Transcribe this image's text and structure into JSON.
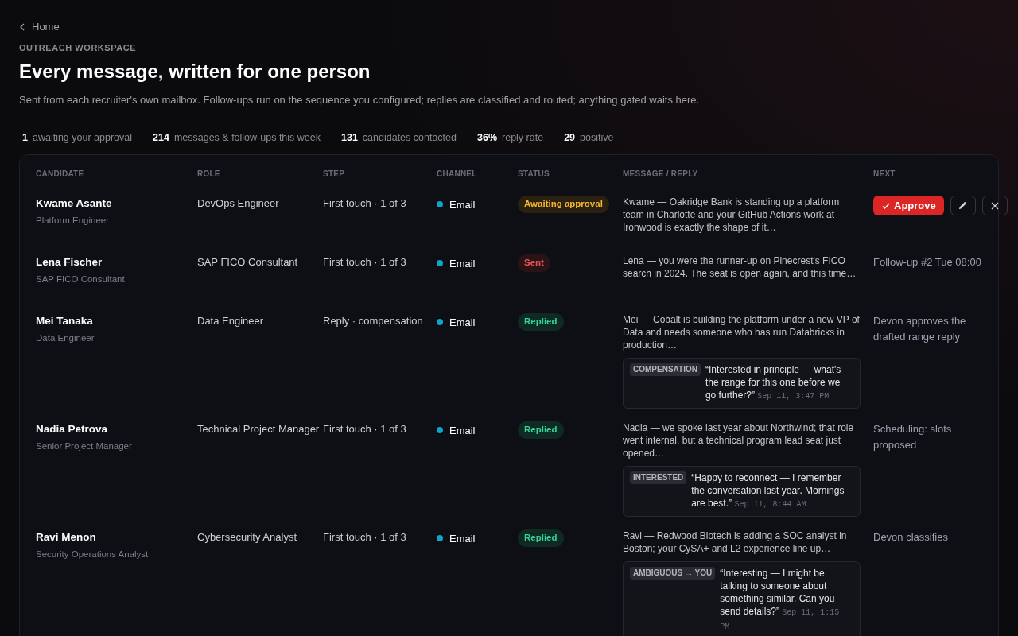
{
  "back_link": {
    "label": "Home"
  },
  "eyebrow": "OUTREACH WORKSPACE",
  "title": "Every message, written for one person",
  "subtitle": "Sent from each recruiter's own mailbox. Follow-ups run on the sequence you configured; replies are classified and routed; anything gated waits here.",
  "stats": [
    {
      "value": "1",
      "label": "awaiting your approval"
    },
    {
      "value": "214",
      "label": "messages & follow-ups this week"
    },
    {
      "value": "131",
      "label": "candidates contacted"
    },
    {
      "value": "36%",
      "label": "reply rate"
    },
    {
      "value": "29",
      "label": "positive"
    }
  ],
  "table": {
    "columns": [
      "CANDIDATE",
      "ROLE",
      "STEP",
      "CHANNEL",
      "STATUS",
      "MESSAGE / REPLY",
      "NEXT"
    ],
    "rows": [
      {
        "name": "Kwame Asante",
        "title": "Platform Engineer",
        "role": "DevOps Engineer",
        "step": "First touch · 1 of 3",
        "channel": "Email",
        "status": {
          "kind": "awaiting",
          "label": "Awaiting approval"
        },
        "message": "Kwame — Oakridge Bank is standing up a platform team in Charlotte and your GitHub Actions work at Ironwood is exactly the shape of it…",
        "next": {
          "kind": "actions",
          "approve": "Approve"
        }
      },
      {
        "name": "Lena Fischer",
        "title": "SAP FICO Consultant",
        "role": "SAP FICO Consultant",
        "step": "First touch · 1 of 3",
        "channel": "Email",
        "status": {
          "kind": "sent",
          "label": "Sent"
        },
        "message": "Lena — you were the runner-up on Pinecrest's FICO search in 2024. The seat is open again, and this time…",
        "next": {
          "kind": "text",
          "text": "Follow-up #2 Tue 08:00"
        }
      },
      {
        "name": "Mei Tanaka",
        "title": "Data Engineer",
        "role": "Data Engineer",
        "step": "Reply · compensation",
        "channel": "Email",
        "status": {
          "kind": "replied",
          "label": "Replied"
        },
        "message": "Mei — Cobalt is building the platform under a new VP of Data and needs someone who has run Databricks in production…",
        "reply": {
          "tag": "COMPENSATION",
          "quote": "“Interested in principle — what's the range for this one before we go further?”",
          "time": "Sep 11, 3:47 PM"
        },
        "next": {
          "kind": "text",
          "text": "Devon approves the drafted range reply"
        }
      },
      {
        "name": "Nadia Petrova",
        "title": "Senior Project Manager",
        "role": "Technical Project Manager",
        "step": "First touch · 1 of 3",
        "channel": "Email",
        "status": {
          "kind": "replied",
          "label": "Replied"
        },
        "message": "Nadia — we spoke last year about Northwind; that role went internal, but a technical program lead seat just opened…",
        "reply": {
          "tag": "INTERESTED",
          "quote": "“Happy to reconnect — I remember the conversation last year. Mornings are best.”",
          "time": "Sep 11, 8:44 AM"
        },
        "next": {
          "kind": "text",
          "text": "Scheduling: slots proposed"
        }
      },
      {
        "name": "Ravi Menon",
        "title": "Security Operations Analyst",
        "role": "Cybersecurity Analyst",
        "step": "First touch · 1 of 3",
        "channel": "Email",
        "status": {
          "kind": "replied",
          "label": "Replied"
        },
        "message": "Ravi — Redwood Biotech is adding a SOC analyst in Boston; your CySA+ and L2 experience line up…",
        "reply": {
          "tag": "AMBIGUOUS → YOU",
          "quote": "“Interesting — I might be talking to someone about something similar. Can you send details?”",
          "time": "Sep 11, 1:15 PM"
        },
        "next": {
          "kind": "text",
          "text": "Devon classifies"
        }
      }
    ]
  }
}
